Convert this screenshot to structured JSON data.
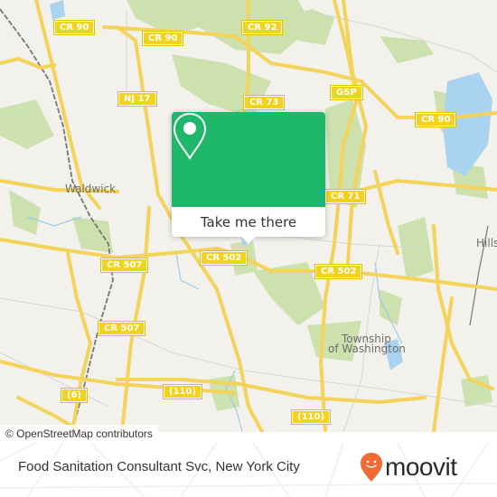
{
  "map": {
    "road_shields": [
      {
        "label": "CR 90"
      },
      {
        "label": "CR 90"
      },
      {
        "label": "CR 92"
      },
      {
        "label": "NJ 17"
      },
      {
        "label": "CR 73"
      },
      {
        "label": "GSP"
      },
      {
        "label": "CR 90"
      },
      {
        "label": "CR 71"
      },
      {
        "label": "CR 507"
      },
      {
        "label": "CR 502"
      },
      {
        "label": "CR 502"
      },
      {
        "label": "CR 507"
      },
      {
        "label": "(6)"
      },
      {
        "label": "(110)"
      },
      {
        "label": "(110)"
      }
    ],
    "places": [
      {
        "label": "Waldwick"
      },
      {
        "label": "Hills"
      },
      {
        "label": "Township"
      },
      {
        "label": "of Washington"
      }
    ],
    "colors": {
      "land": "#f2f1ec",
      "road": "#f7df6a",
      "park": "#c8e0a8",
      "water": "#a9d3ee",
      "rail": "#777777"
    }
  },
  "popup": {
    "icon": "location-pin-icon",
    "button_label": "Take me there",
    "accent": "#1fb86b"
  },
  "attribution": "© OpenStreetMap contributors",
  "footer": {
    "title": "Food Sanitation Consultant Svc, New York City",
    "logo_text": "moovit",
    "logo_color": "#f06a35"
  }
}
